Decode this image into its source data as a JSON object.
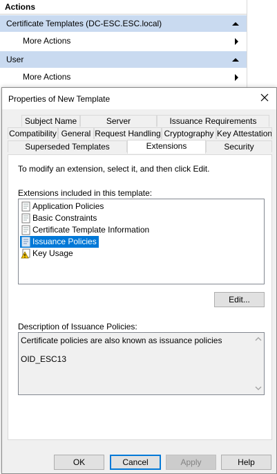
{
  "actions": {
    "header": "Actions",
    "groups": [
      {
        "title": "Certificate Templates (DC-ESC.ESC.local)",
        "item": "More Actions"
      },
      {
        "title": "User",
        "item": "More Actions"
      }
    ]
  },
  "dialog": {
    "title": "Properties of New Template",
    "tabs_row1": [
      "Subject Name",
      "Server",
      "Issuance Requirements"
    ],
    "tabs_row2": [
      "Compatibility",
      "General",
      "Request Handling",
      "Cryptography",
      "Key Attestation"
    ],
    "tabs_row3": [
      "Superseded Templates",
      "Extensions",
      "Security"
    ],
    "active_tab": "Extensions",
    "instruction": "To modify an extension, select it, and then click Edit.",
    "list_label": "Extensions included in this template:",
    "extensions": [
      {
        "label": "Application Policies",
        "icon": "document-icon"
      },
      {
        "label": "Basic Constraints",
        "icon": "document-icon"
      },
      {
        "label": "Certificate Template Information",
        "icon": "document-icon"
      },
      {
        "label": "Issuance Policies",
        "icon": "document-icon",
        "selected": true
      },
      {
        "label": "Key Usage",
        "icon": "warning-document-icon"
      }
    ],
    "edit_button": "Edit...",
    "description_label": "Description of Issuance Policies:",
    "description_lines": [
      "Certificate policies are also known as issuance policies",
      "OID_ESC13"
    ],
    "buttons": {
      "ok": "OK",
      "cancel": "Cancel",
      "apply": "Apply",
      "help": "Help"
    }
  },
  "colors": {
    "group_header": "#c9daf0",
    "selection": "#0078d7",
    "dialog_bg": "#f0f0f0"
  }
}
